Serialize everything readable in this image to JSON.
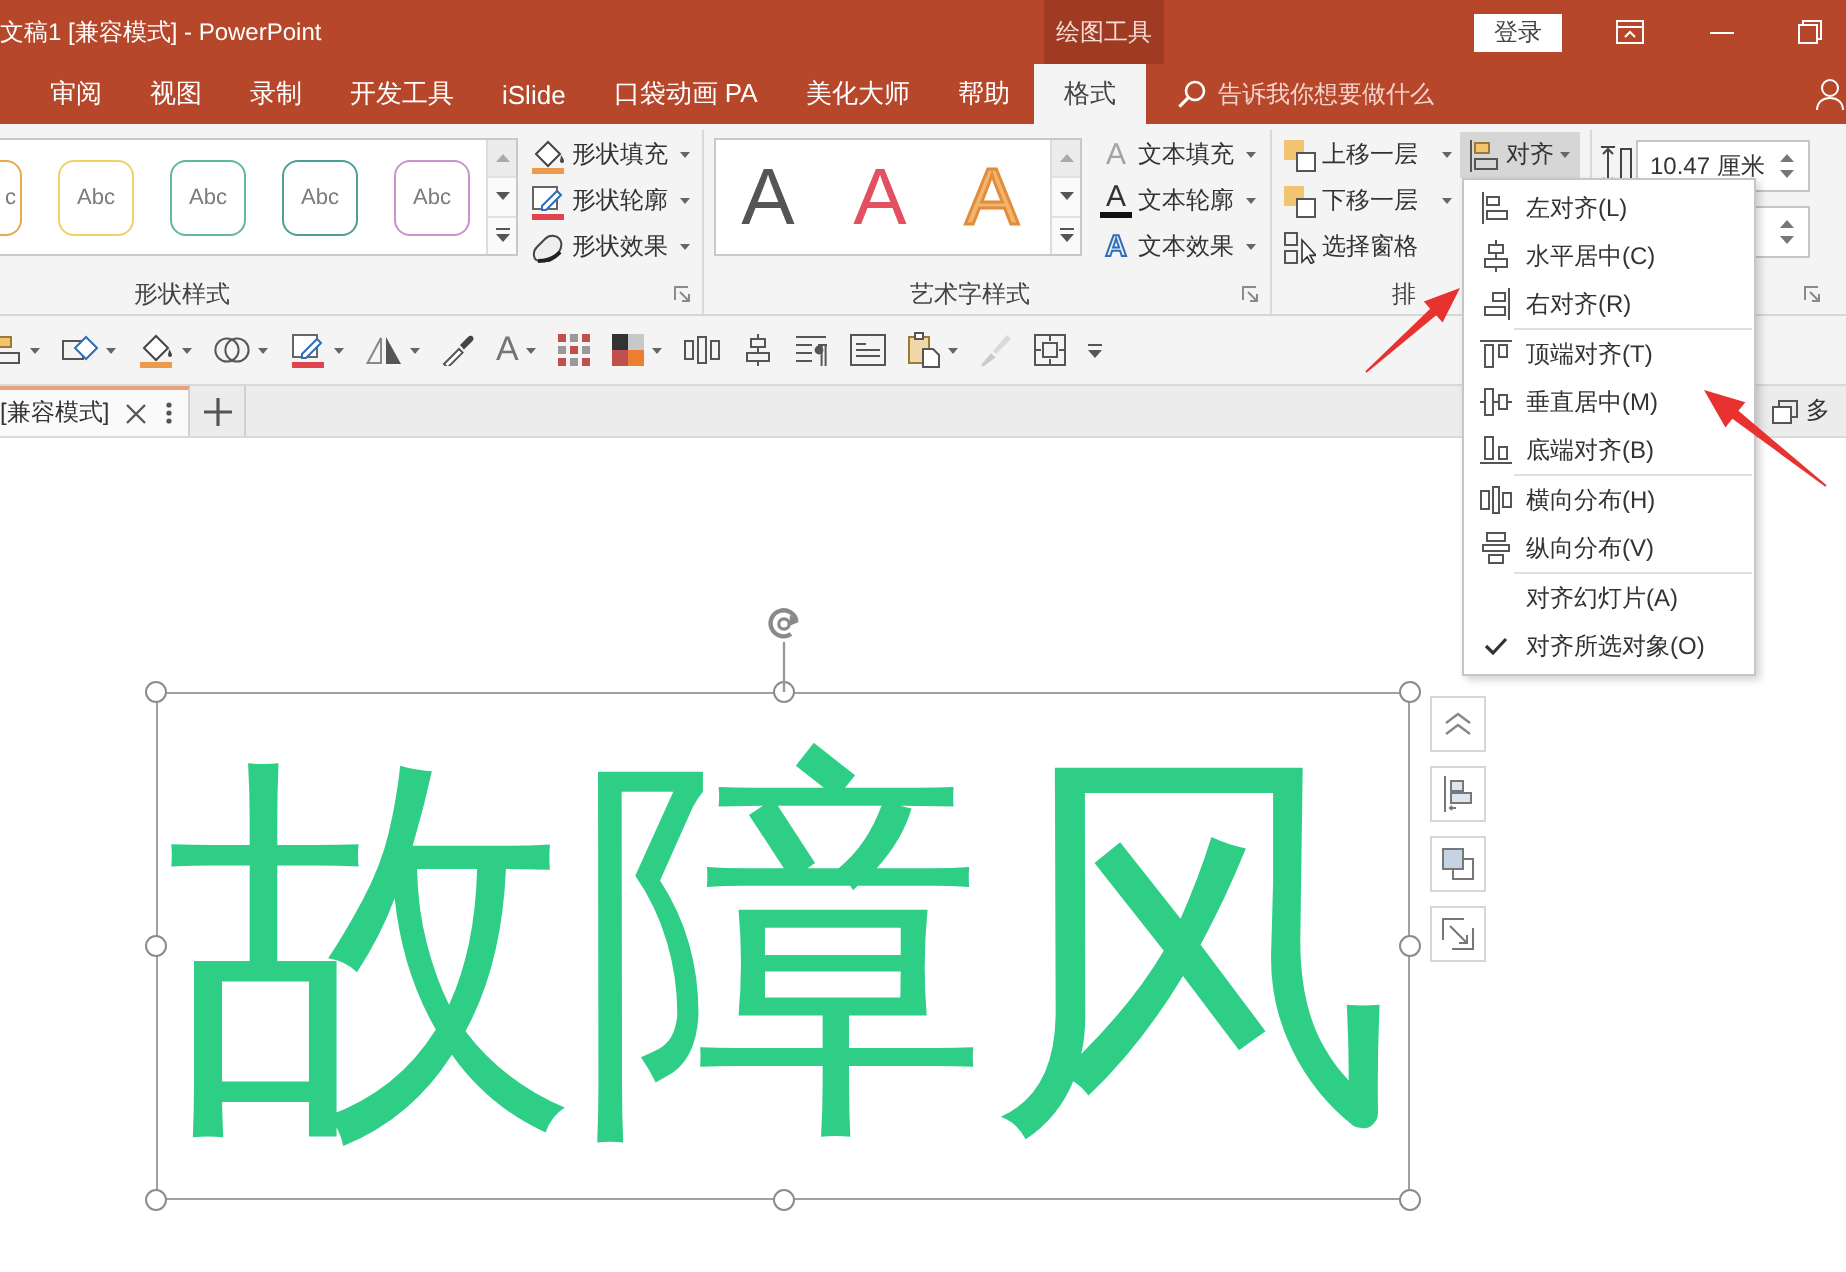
{
  "window": {
    "title": "文稿1 [兼容模式] - PowerPoint",
    "context_label": "绘图工具",
    "sign_in": "登录"
  },
  "tabs": [
    {
      "label": "审阅",
      "selected": false
    },
    {
      "label": "视图",
      "selected": false
    },
    {
      "label": "录制",
      "selected": false
    },
    {
      "label": "开发工具",
      "selected": false
    },
    {
      "label": "iSlide",
      "selected": false
    },
    {
      "label": "口袋动画 PA",
      "selected": false
    },
    {
      "label": "美化大师",
      "selected": false
    },
    {
      "label": "帮助",
      "selected": false
    },
    {
      "label": "格式",
      "selected": true
    }
  ],
  "tell_me": {
    "placeholder": "告诉我你想要做什么"
  },
  "ribbon": {
    "shape_styles": {
      "label": "形状样式",
      "presets": [
        {
          "text": "c",
          "color": "#e9a84c",
          "cut": true
        },
        {
          "text": "Abc",
          "color": "#f0d264",
          "cut": false
        },
        {
          "text": "Abc",
          "color": "#5fb89c",
          "cut": false
        },
        {
          "text": "Abc",
          "color": "#4c9f95",
          "cut": false
        },
        {
          "text": "Abc",
          "color": "#c993cc",
          "cut": false
        }
      ],
      "commands": [
        {
          "kind": "fill",
          "label": "形状填充"
        },
        {
          "kind": "outline",
          "label": "形状轮廓"
        },
        {
          "kind": "effect",
          "label": "形状效果"
        }
      ]
    },
    "wordart_styles": {
      "label": "艺术字样式",
      "presets": [
        {
          "text": "A",
          "kind": "solid",
          "color": "#555555"
        },
        {
          "text": "A",
          "kind": "solid",
          "color": "#e3505f"
        },
        {
          "text": "A",
          "kind": "outline",
          "color": "#f5b46c"
        }
      ],
      "commands": [
        {
          "kind": "fill",
          "glyph": "A",
          "label": "文本填充"
        },
        {
          "kind": "outline",
          "glyph": "A",
          "label": "文本轮廓"
        },
        {
          "kind": "effect",
          "glyph": "A",
          "label": "文本效果"
        }
      ]
    },
    "arrange": {
      "label": "排",
      "commands": [
        {
          "kind": "forward",
          "label": "上移一层",
          "menu": true
        },
        {
          "kind": "backward",
          "label": "下移一层",
          "menu": true
        },
        {
          "kind": "pane",
          "label": "选择窗格",
          "menu": false
        }
      ],
      "align": {
        "label": "对齐",
        "pressed": true,
        "expanded": true,
        "menu": [
          [
            {
              "kind": "left",
              "label": "左对齐(L)",
              "checked": false
            },
            {
              "kind": "center",
              "label": "水平居中(C)",
              "checked": false
            },
            {
              "kind": "right",
              "label": "右对齐(R)",
              "checked": false
            }
          ],
          [
            {
              "kind": "top",
              "label": "顶端对齐(T)",
              "checked": false
            },
            {
              "kind": "middle",
              "label": "垂直居中(M)",
              "checked": false
            },
            {
              "kind": "bottom",
              "label": "底端对齐(B)",
              "checked": false
            }
          ],
          [
            {
              "kind": "hspread",
              "label": "横向分布(H)",
              "checked": false
            },
            {
              "kind": "vspread",
              "label": "纵向分布(V)",
              "checked": false
            }
          ],
          [
            {
              "kind": "option",
              "label": "对齐幻灯片(A)",
              "checked": false
            },
            {
              "kind": "option",
              "label": "对齐所选对象(O)",
              "checked": true
            }
          ]
        ]
      }
    },
    "size": {
      "height": "10.47 厘米"
    }
  },
  "quick_toolbar": [
    {
      "kind": "alignleft",
      "menu": true,
      "disabled": false
    },
    {
      "kind": "shapes",
      "menu": true,
      "disabled": false
    },
    {
      "kind": "fill",
      "menu": true,
      "disabled": false
    },
    {
      "kind": "combine",
      "menu": true,
      "disabled": false
    },
    {
      "kind": "outline",
      "menu": true,
      "disabled": false
    },
    {
      "kind": "flip",
      "menu": true,
      "disabled": false
    },
    {
      "kind": "eyedropper",
      "menu": false,
      "disabled": false
    },
    {
      "kind": "fontcolor",
      "glyph": "A",
      "menu": true,
      "disabled": true
    },
    {
      "kind": "grid",
      "menu": false,
      "disabled": false
    },
    {
      "kind": "colors",
      "menu": true,
      "disabled": false
    },
    {
      "kind": "distribute",
      "menu": false,
      "disabled": false
    },
    {
      "kind": "aligncenter",
      "menu": false,
      "disabled": false
    },
    {
      "kind": "paragraph",
      "menu": false,
      "disabled": false
    },
    {
      "kind": "textbox",
      "menu": false,
      "disabled": false
    },
    {
      "kind": "paste",
      "menu": true,
      "disabled": false
    },
    {
      "kind": "brush",
      "menu": false,
      "disabled": true
    },
    {
      "kind": "fit",
      "menu": false,
      "disabled": false
    },
    {
      "kind": "customize",
      "menu": false,
      "disabled": false
    }
  ],
  "documents": {
    "tabs": [
      {
        "label": "[兼容模式]",
        "selected": true
      }
    ],
    "window_button": "多"
  },
  "slide": {
    "text": "故障风",
    "selected": true
  }
}
